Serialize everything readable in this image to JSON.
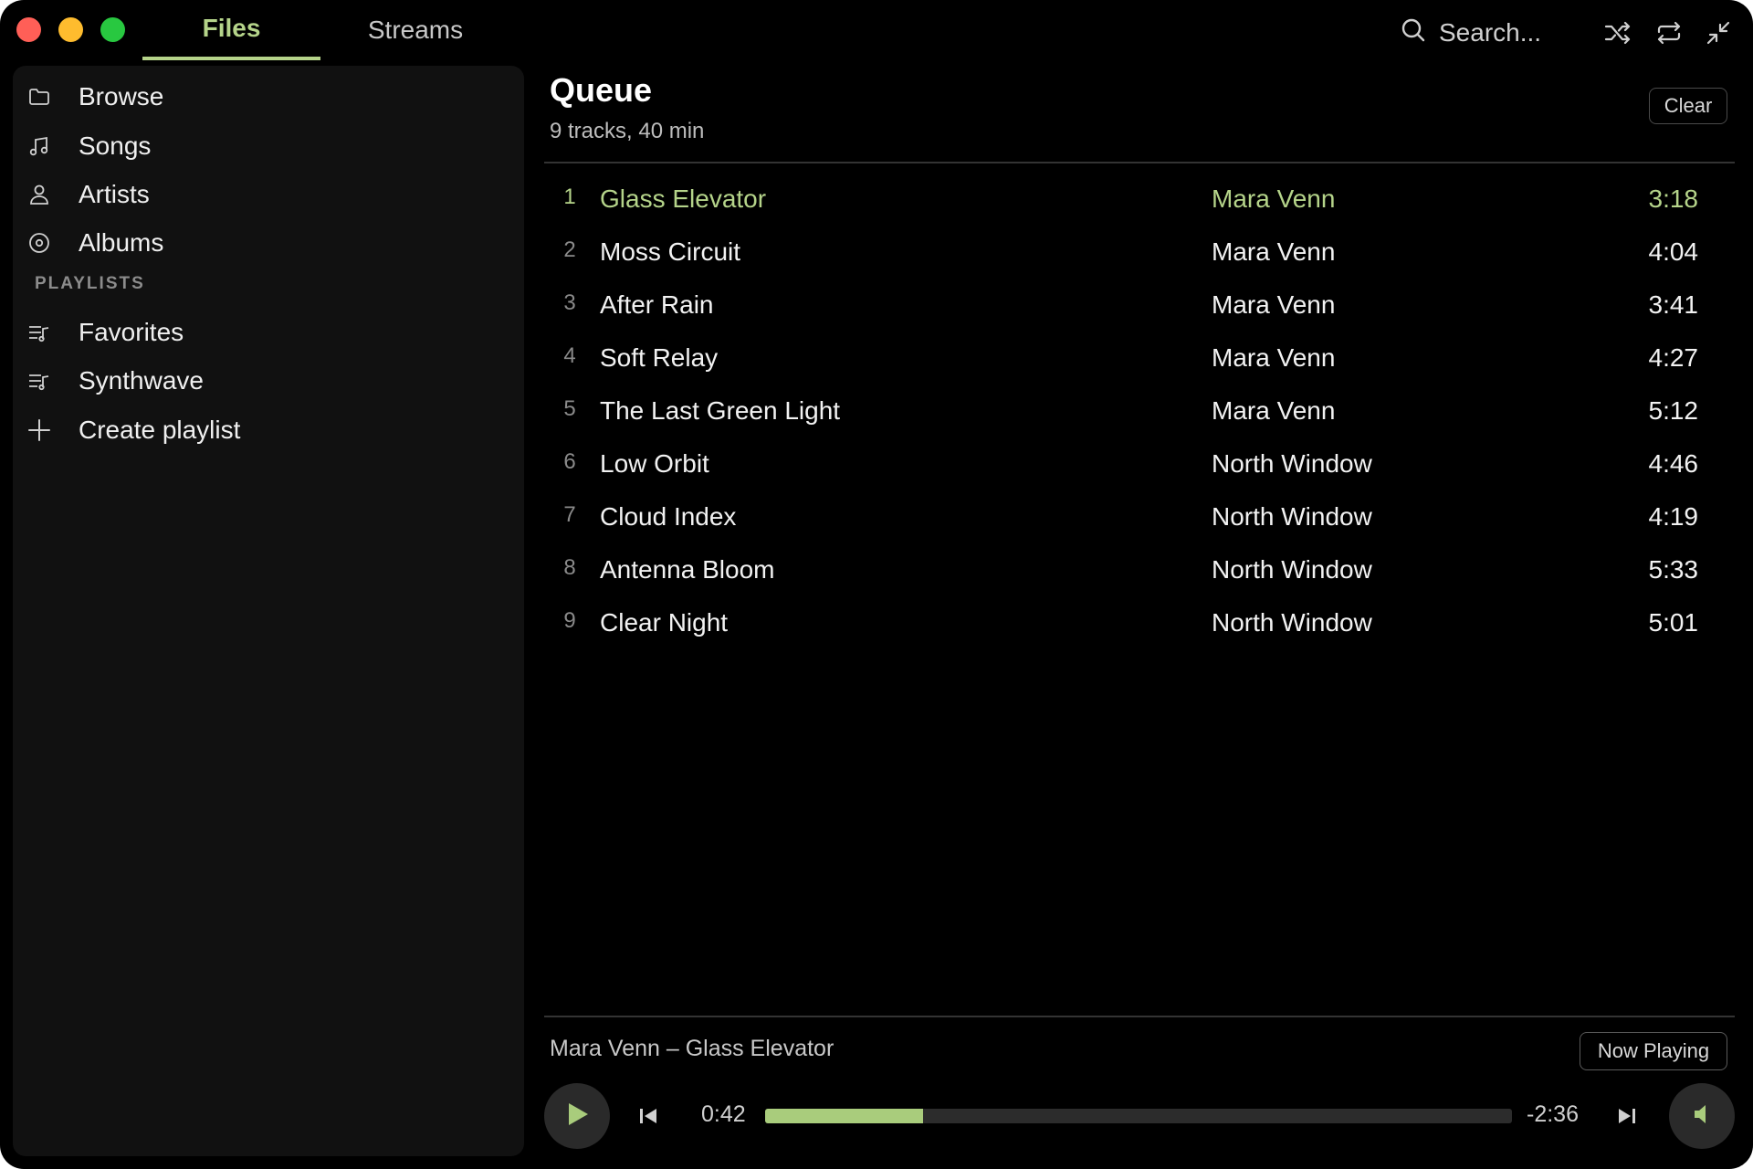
{
  "titlebar": {
    "tabs": [
      {
        "label": "Files",
        "active": true
      },
      {
        "label": "Streams",
        "active": false
      }
    ],
    "search": {
      "icon": "search-icon",
      "placeholder": "Search..."
    },
    "actions": [
      "shuffle-icon",
      "repeat-icon",
      "minimize-icon"
    ]
  },
  "sidebar": {
    "items": [
      {
        "label": "Browse",
        "icon": "folder-icon"
      },
      {
        "label": "Songs",
        "icon": "music-note-icon"
      },
      {
        "label": "Artists",
        "icon": "person-icon"
      },
      {
        "label": "Albums",
        "icon": "disc-icon"
      }
    ],
    "playlists_heading": "PLAYLISTS",
    "playlists": [
      {
        "label": "Favorites",
        "icon": "playlist-icon"
      },
      {
        "label": "Synthwave",
        "icon": "playlist-icon"
      }
    ],
    "create_playlist": {
      "label": "Create playlist",
      "icon": "plus-icon"
    }
  },
  "queue": {
    "title": "Queue",
    "subtitle": "9 tracks, 40 min",
    "clear_label": "Clear",
    "tracks": [
      {
        "num": "1",
        "title": "Glass Elevator",
        "artist": "Mara Venn",
        "duration": "3:18",
        "active": true
      },
      {
        "num": "2",
        "title": "Moss Circuit",
        "artist": "Mara Venn",
        "duration": "4:04",
        "active": false
      },
      {
        "num": "3",
        "title": "After Rain",
        "artist": "Mara Venn",
        "duration": "3:41",
        "active": false
      },
      {
        "num": "4",
        "title": "Soft Relay",
        "artist": "Mara Venn",
        "duration": "4:27",
        "active": false
      },
      {
        "num": "5",
        "title": "The Last Green Light",
        "artist": "Mara Venn",
        "duration": "5:12",
        "active": false
      },
      {
        "num": "6",
        "title": "Low Orbit",
        "artist": "North Window",
        "duration": "4:46",
        "active": false
      },
      {
        "num": "7",
        "title": "Cloud Index",
        "artist": "North Window",
        "duration": "4:19",
        "active": false
      },
      {
        "num": "8",
        "title": "Antenna Bloom",
        "artist": "North Window",
        "duration": "5:33",
        "active": false
      },
      {
        "num": "9",
        "title": "Clear Night",
        "artist": "North Window",
        "duration": "5:01",
        "active": false
      }
    ]
  },
  "player": {
    "now_playing_text": "Mara Venn – Glass Elevator",
    "now_playing_button": "Now Playing",
    "elapsed": "0:42",
    "remaining": "-2:36",
    "progress": 0.212
  },
  "colors": {
    "accent": "#b5d48a",
    "progress_fill": "#a9cc7c",
    "background": "#000000",
    "sidebar_bg": "#111111",
    "traffic_red": "#ff5f57",
    "traffic_yellow": "#febc2e",
    "traffic_green": "#28c840"
  }
}
